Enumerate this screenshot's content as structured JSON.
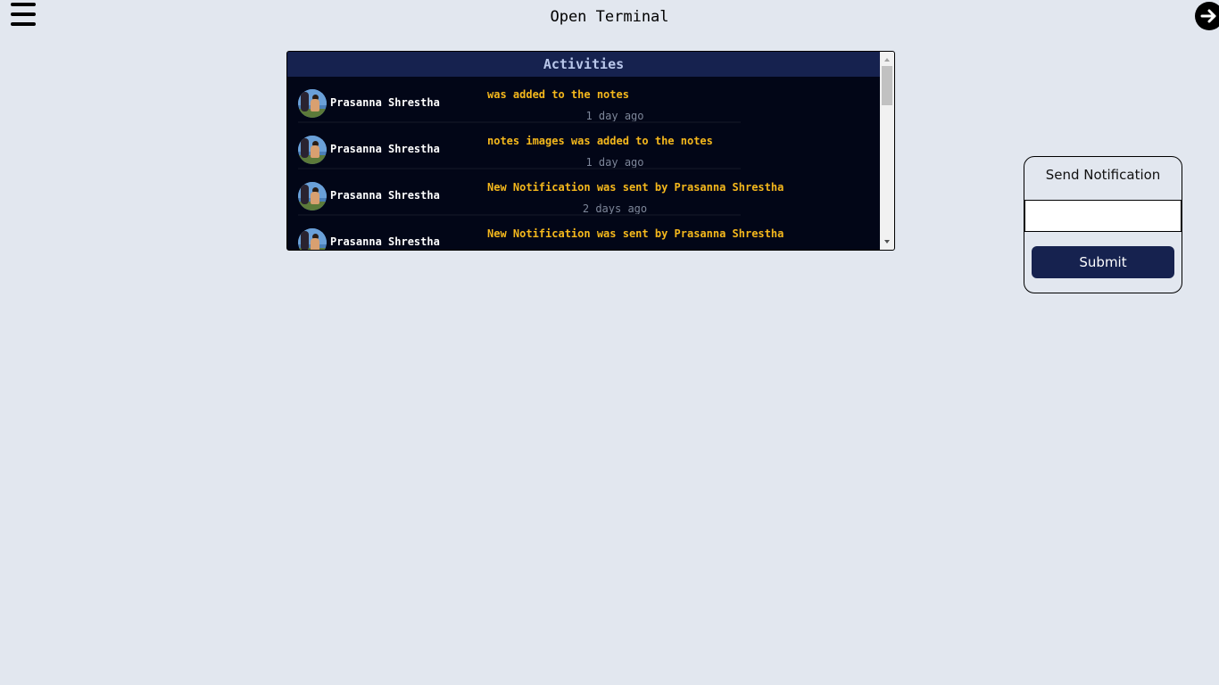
{
  "header": {
    "title": "Open Terminal",
    "menu_icon": "hamburger-menu-icon",
    "logout_icon": "arrow-right-circle-icon"
  },
  "activities": {
    "title": "Activities",
    "items": [
      {
        "user": "Prasanna Shrestha",
        "text": "was added to the notes",
        "time": "1 day ago"
      },
      {
        "user": "Prasanna Shrestha",
        "text": "notes images was added to the notes",
        "time": "1 day ago"
      },
      {
        "user": "Prasanna Shrestha",
        "text": "New Notification was sent by Prasanna Shrestha",
        "time": "2 days ago"
      },
      {
        "user": "Prasanna Shrestha",
        "text": "New Notification was sent by Prasanna Shrestha",
        "time": ""
      }
    ]
  },
  "notification": {
    "title": "Send Notification",
    "input_value": "",
    "submit_label": "Submit"
  },
  "colors": {
    "background": "#e2e7ef",
    "panel": "#020617",
    "header": "#16224f",
    "activity_text": "#f5b81c",
    "accent_button": "#16224f"
  }
}
